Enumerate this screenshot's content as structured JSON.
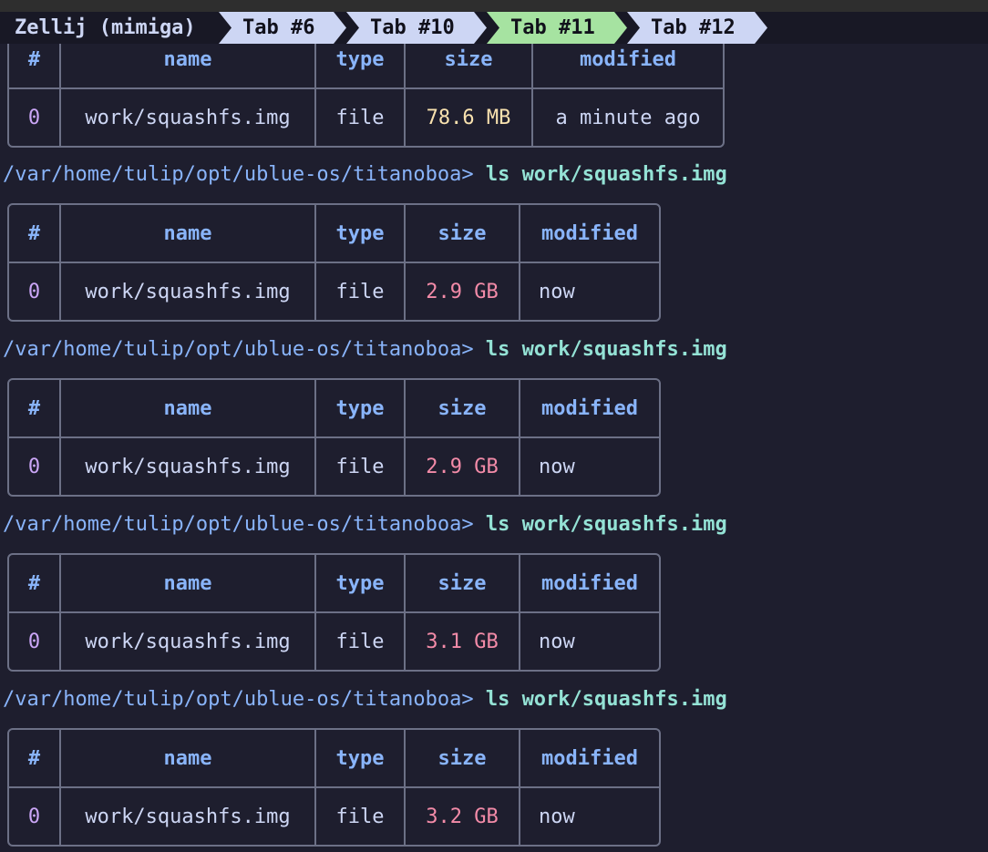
{
  "tabbar": {
    "session": "Zellij (mimiga)",
    "tabs": [
      {
        "label": "Tab #6",
        "active": false
      },
      {
        "label": "Tab #10",
        "active": false
      },
      {
        "label": "Tab #11",
        "active": true
      },
      {
        "label": "Tab #12",
        "active": false
      }
    ]
  },
  "columns": [
    "#",
    "name",
    "type",
    "size",
    "modified"
  ],
  "prompt": {
    "path": "/var/home/tulip/opt/ublue-os/titanoboa",
    "symbol": "> ",
    "command": "ls work/squashfs.img"
  },
  "outputs": [
    {
      "row": {
        "index": "0",
        "name": "work/squashfs.img",
        "type": "file",
        "size": "78.6 MB",
        "modified": "a minute ago"
      }
    },
    {
      "row": {
        "index": "0",
        "name": "work/squashfs.img",
        "type": "file",
        "size": "2.9 GB",
        "modified": "now"
      }
    },
    {
      "row": {
        "index": "0",
        "name": "work/squashfs.img",
        "type": "file",
        "size": "2.9 GB",
        "modified": "now"
      }
    },
    {
      "row": {
        "index": "0",
        "name": "work/squashfs.img",
        "type": "file",
        "size": "3.1 GB",
        "modified": "now"
      }
    },
    {
      "row": {
        "index": "0",
        "name": "work/squashfs.img",
        "type": "file",
        "size": "3.2 GB",
        "modified": "now"
      }
    }
  ],
  "colors": {
    "bg": "#1e1e2e",
    "path": "#89b4fa",
    "command": "#94e2d5",
    "mb": "#f9e2af",
    "gb": "#f38ba8",
    "active_tab": "#a6e3a1"
  }
}
